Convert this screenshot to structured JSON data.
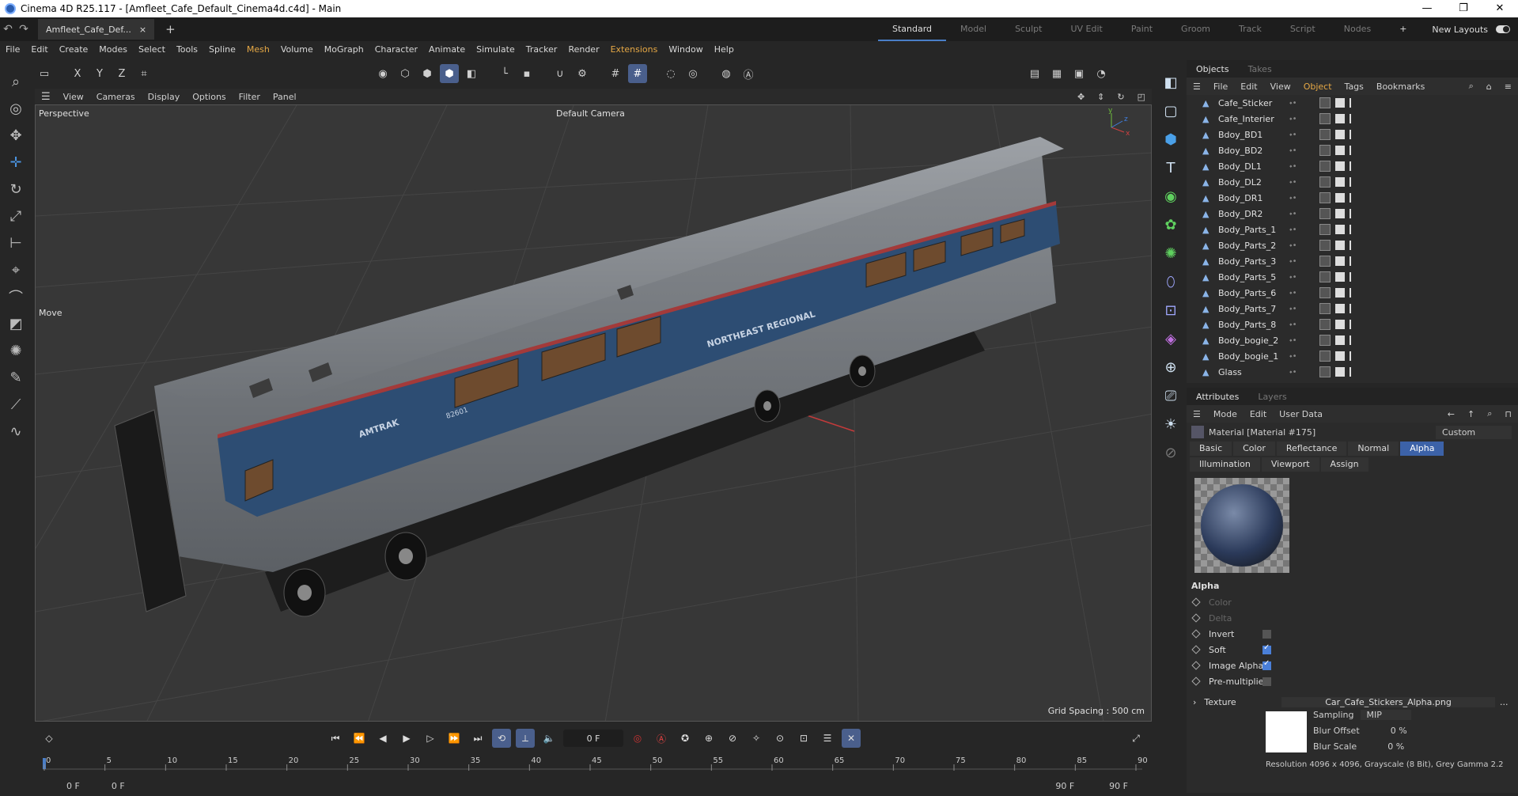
{
  "window": {
    "title": "Cinema 4D R25.117 - [Amfleet_Cafe_Default_Cinema4d.c4d] - Main",
    "minimize": "—",
    "maximize": "❐",
    "close": "✕"
  },
  "tabs": {
    "document": "Amfleet_Cafe_Def...",
    "close": "×",
    "add": "+"
  },
  "layouts": {
    "items": [
      "Standard",
      "Model",
      "Sculpt",
      "UV Edit",
      "Paint",
      "Groom",
      "Track",
      "Script",
      "Nodes"
    ],
    "active": "Standard",
    "add": "+",
    "new_layouts": "New Layouts"
  },
  "menu": [
    "File",
    "Edit",
    "Create",
    "Modes",
    "Select",
    "Tools",
    "Spline",
    "Mesh",
    "Volume",
    "MoGraph",
    "Character",
    "Animate",
    "Simulate",
    "Tracker",
    "Render",
    "Extensions",
    "Window",
    "Help"
  ],
  "viewport_menu": [
    "View",
    "Cameras",
    "Display",
    "Options",
    "Filter",
    "Panel"
  ],
  "viewport": {
    "projection": "Perspective",
    "camera": "Default Camera",
    "tool": "Move",
    "grid_spacing": "Grid Spacing : 500 cm",
    "car": {
      "brand": "AMTRAK",
      "livery": "NORTHEAST REGIONAL",
      "number": "82601"
    }
  },
  "timeline": {
    "current_frame": "0 F",
    "ticks": [
      "0",
      "5",
      "10",
      "15",
      "20",
      "25",
      "30",
      "35",
      "40",
      "45",
      "50",
      "55",
      "60",
      "65",
      "70",
      "75",
      "80",
      "85",
      "90"
    ],
    "start": "0 F",
    "start2": "0 F",
    "end": "90 F",
    "end2": "90 F"
  },
  "objects_panel": {
    "tabs": [
      "Objects",
      "Takes"
    ],
    "menu": [
      "File",
      "Edit",
      "View",
      "Object",
      "Tags",
      "Bookmarks"
    ],
    "active_menu": "Object",
    "items": [
      "Cafe_Sticker",
      "Cafe_Interier",
      "Bdoy_BD1",
      "Bdoy_BD2",
      "Body_DL1",
      "Body_DL2",
      "Body_DR1",
      "Body_DR2",
      "Body_Parts_1",
      "Body_Parts_2",
      "Body_Parts_3",
      "Body_Parts_5",
      "Body_Parts_6",
      "Body_Parts_7",
      "Body_Parts_8",
      "Body_bogie_2",
      "Body_bogie_1",
      "Glass"
    ]
  },
  "attributes_panel": {
    "tabs": [
      "Attributes",
      "Layers"
    ],
    "menu": [
      "Mode",
      "Edit",
      "User Data"
    ],
    "material": "Material [Material #175]",
    "preset": "Custom",
    "channel_tabs": [
      "Basic",
      "Color",
      "Reflectance",
      "Normal",
      "Alpha",
      "Illumination",
      "Viewport",
      "Assign"
    ],
    "active_channel": "Alpha",
    "section": "Alpha",
    "color_label": "Color",
    "delta_label": "Delta",
    "invert_label": "Invert",
    "invert": false,
    "soft_label": "Soft",
    "soft": true,
    "image_alpha_label": "Image Alpha",
    "image_alpha": true,
    "premult_label": "Pre-multiplied",
    "premult": false,
    "texture_label": "Texture",
    "texture_file": "Car_Cafe_Stickers_Alpha.png",
    "texture_more": "...",
    "sampling_label": "Sampling",
    "sampling": "MIP",
    "blur_offset_label": "Blur Offset",
    "blur_offset": "0 %",
    "blur_scale_label": "Blur Scale",
    "blur_scale": "0 %",
    "resolution": "Resolution 4096 x 4096, Grayscale (8 Bit), Grey Gamma 2.2"
  },
  "colors": {
    "accent": "#4a7ec7",
    "highlight_menu": "#e6a845",
    "active_tab": "#3c62a8"
  }
}
